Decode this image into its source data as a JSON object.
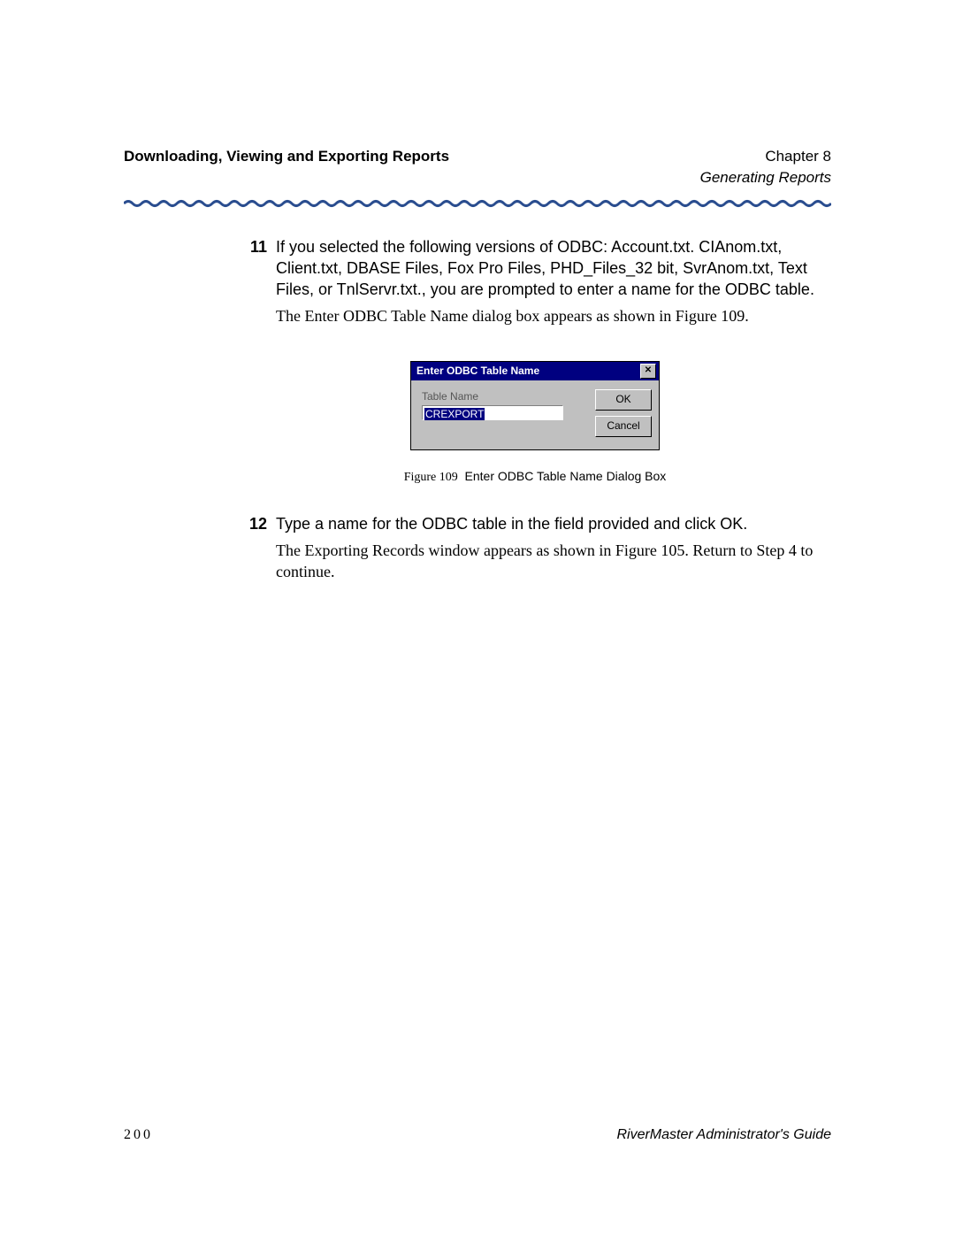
{
  "header": {
    "section_title": "Downloading, Viewing and Exporting Reports",
    "chapter": "Chapter 8",
    "subtitle": "Generating Reports"
  },
  "steps": [
    {
      "num": "11",
      "para1": "If you selected the following versions of ODBC: Account.txt. CIAnom.txt, Client.txt, DBASE Files, Fox Pro Files, PHD_Files_32 bit, SvrAnom.txt, Text Files, or TnlServr.txt., you are prompted to enter a name for the ODBC table.",
      "para2": "The Enter ODBC Table Name dialog box appears as shown in Figure 109."
    },
    {
      "num": "12",
      "para1": "Type a name for the ODBC table in the field provided and click OK.",
      "para2": "The Exporting Records window appears as shown in Figure 105. Return to Step 4 to continue."
    }
  ],
  "dialog": {
    "title": "Enter ODBC Table Name",
    "field_label": "Table Name",
    "field_value": "CREXPORT",
    "ok": "OK",
    "cancel": "Cancel"
  },
  "figure": {
    "num": "Figure 109",
    "caption": "Enter ODBC Table Name Dialog Box"
  },
  "footer": {
    "page": "200",
    "guide": "RiverMaster Administrator's Guide"
  }
}
